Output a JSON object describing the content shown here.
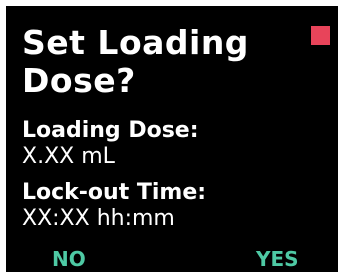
{
  "screen": {
    "title_line1": "Set Loading",
    "title_line2": "Dose?",
    "loading_dose": {
      "label": "Loading Dose:",
      "value": "X.XX mL"
    },
    "lockout_time": {
      "label": "Lock-out Time:",
      "value": "XX:XX hh:mm"
    }
  },
  "softkeys": {
    "left_label": "NO",
    "right_label": "YES"
  },
  "colors": {
    "background": "#000000",
    "text": "#ffffff",
    "softkey_text": "#4ec9a4",
    "indicator": "#e8445a"
  }
}
